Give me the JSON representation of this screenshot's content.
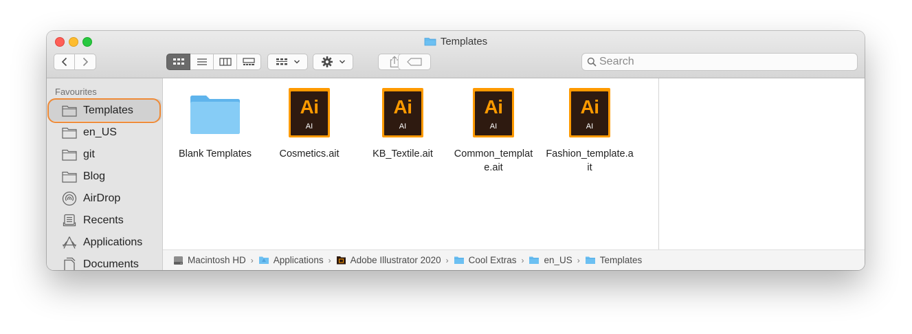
{
  "window": {
    "title": "Templates"
  },
  "toolbar": {
    "back_label": "Back",
    "forward_label": "Forward",
    "view_icon": "grid-icon",
    "group_icon": "group-grid-icon",
    "action_icon": "gear-icon",
    "share_icon": "share-icon",
    "tag_icon": "tag-icon"
  },
  "search": {
    "placeholder": "Search",
    "value": ""
  },
  "sidebar": {
    "header": "Favourites",
    "items": [
      {
        "label": "Templates",
        "icon": "folder-icon",
        "selected": true
      },
      {
        "label": "en_US",
        "icon": "folder-icon"
      },
      {
        "label": "git",
        "icon": "folder-icon"
      },
      {
        "label": "Blog",
        "icon": "folder-icon"
      },
      {
        "label": "AirDrop",
        "icon": "airdrop-icon"
      },
      {
        "label": "Recents",
        "icon": "recents-icon"
      },
      {
        "label": "Applications",
        "icon": "applications-icon"
      },
      {
        "label": "Documents",
        "icon": "documents-icon"
      }
    ]
  },
  "files": [
    {
      "name": "Blank Templates",
      "type": "folder"
    },
    {
      "name": "Cosmetics.ait",
      "type": "ai",
      "badge_big": "Ai",
      "badge_small": "AI"
    },
    {
      "name": "KB_Textile.ait",
      "type": "ai",
      "badge_big": "Ai",
      "badge_small": "AI"
    },
    {
      "name": "Common_template.ait",
      "type": "ai",
      "badge_big": "Ai",
      "badge_small": "AI"
    },
    {
      "name": "Fashion_template.ait",
      "type": "ai",
      "badge_big": "Ai",
      "badge_small": "AI"
    }
  ],
  "pathbar": {
    "items": [
      {
        "label": "Macintosh HD",
        "icon": "hard-drive-icon"
      },
      {
        "label": "Applications",
        "icon": "folder-icon"
      },
      {
        "label": "Adobe Illustrator 2020",
        "icon": "illustrator-app-icon"
      },
      {
        "label": "Cool Extras",
        "icon": "folder-icon"
      },
      {
        "label": "en_US",
        "icon": "folder-icon"
      },
      {
        "label": "Templates",
        "icon": "folder-icon"
      }
    ]
  },
  "colors": {
    "accent_ring": "#ef8a36",
    "ai_orange": "#ff9a00",
    "ai_dark": "#2e1a10",
    "folder_blue": "#6cc0f2"
  }
}
